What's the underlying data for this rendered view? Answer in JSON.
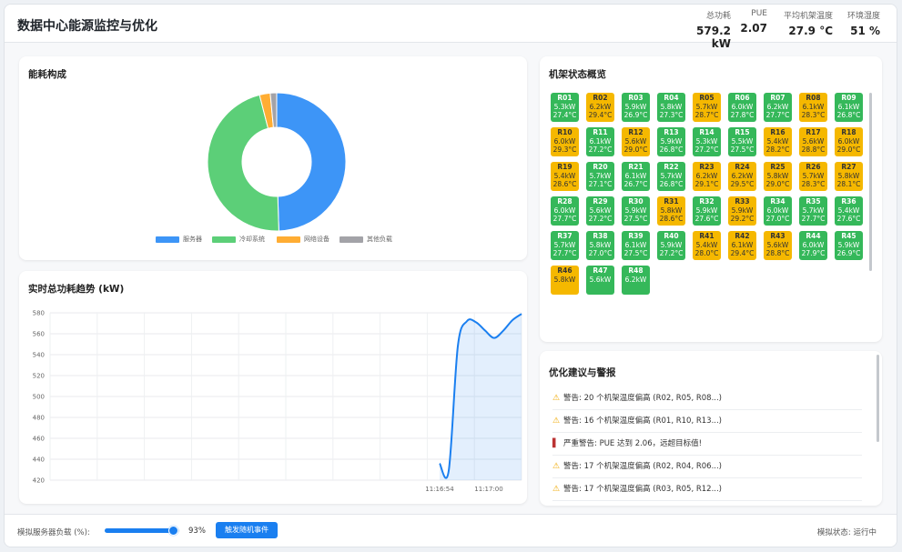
{
  "header": {
    "title": "数据中心能源监控与优化",
    "metrics": [
      {
        "label": "总功耗",
        "value": "579.2 kW"
      },
      {
        "label": "PUE",
        "value": "2.07"
      },
      {
        "label": "平均机架温度",
        "value": "27.9 °C"
      },
      {
        "label": "环境湿度",
        "value": "51 %"
      }
    ]
  },
  "energy": {
    "title": "能耗构成",
    "chart_data": {
      "type": "pie",
      "categories": [
        "服务器",
        "冷却系统",
        "网络设备",
        "其他负载"
      ],
      "values": [
        49.5,
        46.5,
        2.5,
        1.5
      ],
      "colors": [
        "#3d95f7",
        "#5ccf78",
        "#ffad33",
        "#a3a3a8"
      ],
      "legend": "bottom"
    }
  },
  "trend": {
    "title": "实时总功耗趋势 (kW)",
    "chart_data": {
      "type": "area",
      "x": [
        "11:16:54",
        "",
        "",
        "",
        "",
        "11:17:00",
        "",
        "",
        "",
        "",
        ""
      ],
      "xlabels": [
        "11:16:54",
        "11:17:00"
      ],
      "series": [
        {
          "values": [
            436,
            429,
            548,
            572,
            571,
            563,
            556,
            563,
            573,
            579
          ]
        }
      ],
      "ylim": [
        420,
        580
      ],
      "yticks": [
        420,
        440,
        460,
        480,
        500,
        520,
        540,
        560,
        580
      ],
      "grid": true,
      "color": "#1a7ff0"
    }
  },
  "racks": {
    "title": "机架状态概览",
    "items": [
      {
        "id": "R01",
        "p": "5.3kW",
        "t": "27.4°C",
        "s": "ok"
      },
      {
        "id": "R02",
        "p": "6.2kW",
        "t": "29.4°C",
        "s": "warn"
      },
      {
        "id": "R03",
        "p": "5.9kW",
        "t": "26.9°C",
        "s": "ok"
      },
      {
        "id": "R04",
        "p": "5.8kW",
        "t": "27.3°C",
        "s": "ok"
      },
      {
        "id": "R05",
        "p": "5.7kW",
        "t": "28.7°C",
        "s": "warn"
      },
      {
        "id": "R06",
        "p": "6.0kW",
        "t": "27.8°C",
        "s": "ok"
      },
      {
        "id": "R07",
        "p": "6.2kW",
        "t": "27.7°C",
        "s": "ok"
      },
      {
        "id": "R08",
        "p": "6.1kW",
        "t": "28.3°C",
        "s": "warn"
      },
      {
        "id": "R09",
        "p": "6.1kW",
        "t": "26.8°C",
        "s": "ok"
      },
      {
        "id": "R10",
        "p": "6.0kW",
        "t": "29.3°C",
        "s": "warn"
      },
      {
        "id": "R11",
        "p": "6.1kW",
        "t": "27.2°C",
        "s": "ok"
      },
      {
        "id": "R12",
        "p": "5.6kW",
        "t": "29.0°C",
        "s": "warn"
      },
      {
        "id": "R13",
        "p": "5.9kW",
        "t": "26.8°C",
        "s": "ok"
      },
      {
        "id": "R14",
        "p": "5.3kW",
        "t": "27.2°C",
        "s": "ok"
      },
      {
        "id": "R15",
        "p": "5.5kW",
        "t": "27.5°C",
        "s": "ok"
      },
      {
        "id": "R16",
        "p": "5.4kW",
        "t": "28.2°C",
        "s": "warn"
      },
      {
        "id": "R17",
        "p": "5.6kW",
        "t": "28.8°C",
        "s": "warn"
      },
      {
        "id": "R18",
        "p": "6.0kW",
        "t": "29.0°C",
        "s": "warn"
      },
      {
        "id": "R19",
        "p": "5.4kW",
        "t": "28.6°C",
        "s": "warn"
      },
      {
        "id": "R20",
        "p": "5.7kW",
        "t": "27.1°C",
        "s": "ok"
      },
      {
        "id": "R21",
        "p": "6.1kW",
        "t": "26.7°C",
        "s": "ok"
      },
      {
        "id": "R22",
        "p": "5.7kW",
        "t": "26.8°C",
        "s": "ok"
      },
      {
        "id": "R23",
        "p": "6.2kW",
        "t": "29.1°C",
        "s": "warn"
      },
      {
        "id": "R24",
        "p": "6.2kW",
        "t": "29.5°C",
        "s": "warn"
      },
      {
        "id": "R25",
        "p": "5.8kW",
        "t": "29.0°C",
        "s": "warn"
      },
      {
        "id": "R26",
        "p": "5.7kW",
        "t": "28.3°C",
        "s": "warn"
      },
      {
        "id": "R27",
        "p": "5.8kW",
        "t": "28.1°C",
        "s": "warn"
      },
      {
        "id": "R28",
        "p": "6.0kW",
        "t": "27.7°C",
        "s": "ok"
      },
      {
        "id": "R29",
        "p": "5.6kW",
        "t": "27.2°C",
        "s": "ok"
      },
      {
        "id": "R30",
        "p": "5.9kW",
        "t": "27.5°C",
        "s": "ok"
      },
      {
        "id": "R31",
        "p": "5.8kW",
        "t": "28.6°C",
        "s": "warn"
      },
      {
        "id": "R32",
        "p": "5.9kW",
        "t": "27.6°C",
        "s": "ok"
      },
      {
        "id": "R33",
        "p": "5.9kW",
        "t": "29.2°C",
        "s": "warn"
      },
      {
        "id": "R34",
        "p": "6.0kW",
        "t": "27.0°C",
        "s": "ok"
      },
      {
        "id": "R35",
        "p": "5.7kW",
        "t": "27.7°C",
        "s": "ok"
      },
      {
        "id": "R36",
        "p": "5.4kW",
        "t": "27.6°C",
        "s": "ok"
      },
      {
        "id": "R37",
        "p": "5.7kW",
        "t": "27.7°C",
        "s": "ok"
      },
      {
        "id": "R38",
        "p": "5.8kW",
        "t": "27.0°C",
        "s": "ok"
      },
      {
        "id": "R39",
        "p": "6.1kW",
        "t": "27.5°C",
        "s": "ok"
      },
      {
        "id": "R40",
        "p": "5.9kW",
        "t": "27.2°C",
        "s": "ok"
      },
      {
        "id": "R41",
        "p": "5.4kW",
        "t": "28.0°C",
        "s": "warn"
      },
      {
        "id": "R42",
        "p": "6.1kW",
        "t": "29.4°C",
        "s": "warn"
      },
      {
        "id": "R43",
        "p": "5.6kW",
        "t": "28.8°C",
        "s": "warn"
      },
      {
        "id": "R44",
        "p": "6.0kW",
        "t": "27.9°C",
        "s": "ok"
      },
      {
        "id": "R45",
        "p": "5.9kW",
        "t": "26.9°C",
        "s": "ok"
      },
      {
        "id": "R46",
        "p": "5.8kW",
        "t": "",
        "s": "warn"
      },
      {
        "id": "R47",
        "p": "5.6kW",
        "t": "",
        "s": "ok"
      },
      {
        "id": "R48",
        "p": "6.2kW",
        "t": "",
        "s": "ok"
      }
    ]
  },
  "alerts": {
    "title": "优化建议与警报",
    "items": [
      {
        "level": "warn",
        "text": "警告: 20 个机架温度偏高 (R02, R05, R08...)"
      },
      {
        "level": "warn",
        "text": "警告: 16 个机架温度偏高 (R01, R10, R13...)"
      },
      {
        "level": "critical",
        "text": "严重警告: PUE 达到 2.06，远超目标值!"
      },
      {
        "level": "warn",
        "text": "警告: 17 个机架温度偏高 (R02, R04, R06...)"
      },
      {
        "level": "warn",
        "text": "警告: 17 个机架温度偏高 (R03, R05, R12...)"
      }
    ]
  },
  "footer": {
    "slider_label": "模拟服务器负载 (%):",
    "slider_value": 93,
    "slider_value_text": "93%",
    "button_label": "触发随机事件",
    "status_text": "模拟状态: 运行中"
  },
  "icons": {
    "warn": "warning-triangle-icon",
    "critical": "critical-bar-icon"
  },
  "colors": {
    "accent": "#1a7ff0",
    "ok": "#35b85a",
    "warn": "#f5b800",
    "critical": "#b33333"
  }
}
